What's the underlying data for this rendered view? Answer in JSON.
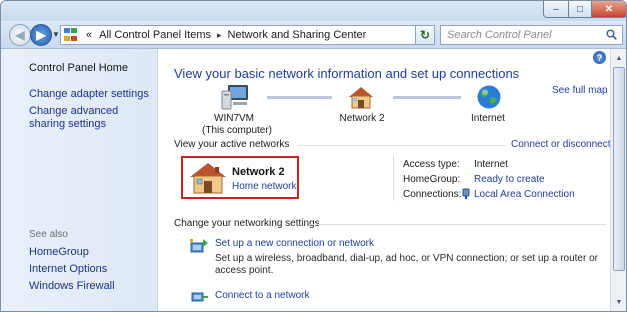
{
  "window": {
    "controls": {
      "minimize": "–",
      "maximize": "□",
      "close": "✕"
    },
    "colors": {
      "link": "#1f3d9b",
      "highlight_box": "#cc2222"
    }
  },
  "addressbar": {
    "overflow": "«",
    "breadcrumbs": [
      "All Control Panel Items",
      "Network and Sharing Center"
    ],
    "separator": "▸",
    "search_placeholder": "Search Control Panel"
  },
  "sidebar": {
    "home": "Control Panel Home",
    "tasks": [
      "Change adapter settings",
      "Change advanced sharing settings"
    ],
    "see_also_title": "See also",
    "see_also": [
      "HomeGroup",
      "Internet Options",
      "Windows Firewall"
    ]
  },
  "main": {
    "heading": "View your basic network information and set up connections",
    "see_full_map": "See full map",
    "map": {
      "computer_name": "WIN7VM",
      "computer_note": "(This computer)",
      "network": "Network  2",
      "internet": "Internet"
    },
    "active_label": "View your active networks",
    "connect_disconnect": "Connect or disconnect",
    "network_name": "Network  2",
    "network_type": "Home network",
    "props": [
      {
        "label": "Access type:",
        "value": "Internet"
      },
      {
        "label": "HomeGroup:",
        "value": "Ready to create"
      },
      {
        "label": "Connections:",
        "value": "Local Area Connection"
      }
    ],
    "change_label": "Change your networking settings",
    "tasks": [
      {
        "title": "Set up a new connection or network",
        "desc": "Set up a wireless, broadband, dial-up, ad hoc, or VPN connection; or set up a router or access point."
      },
      {
        "title": "Connect to a network"
      }
    ]
  }
}
